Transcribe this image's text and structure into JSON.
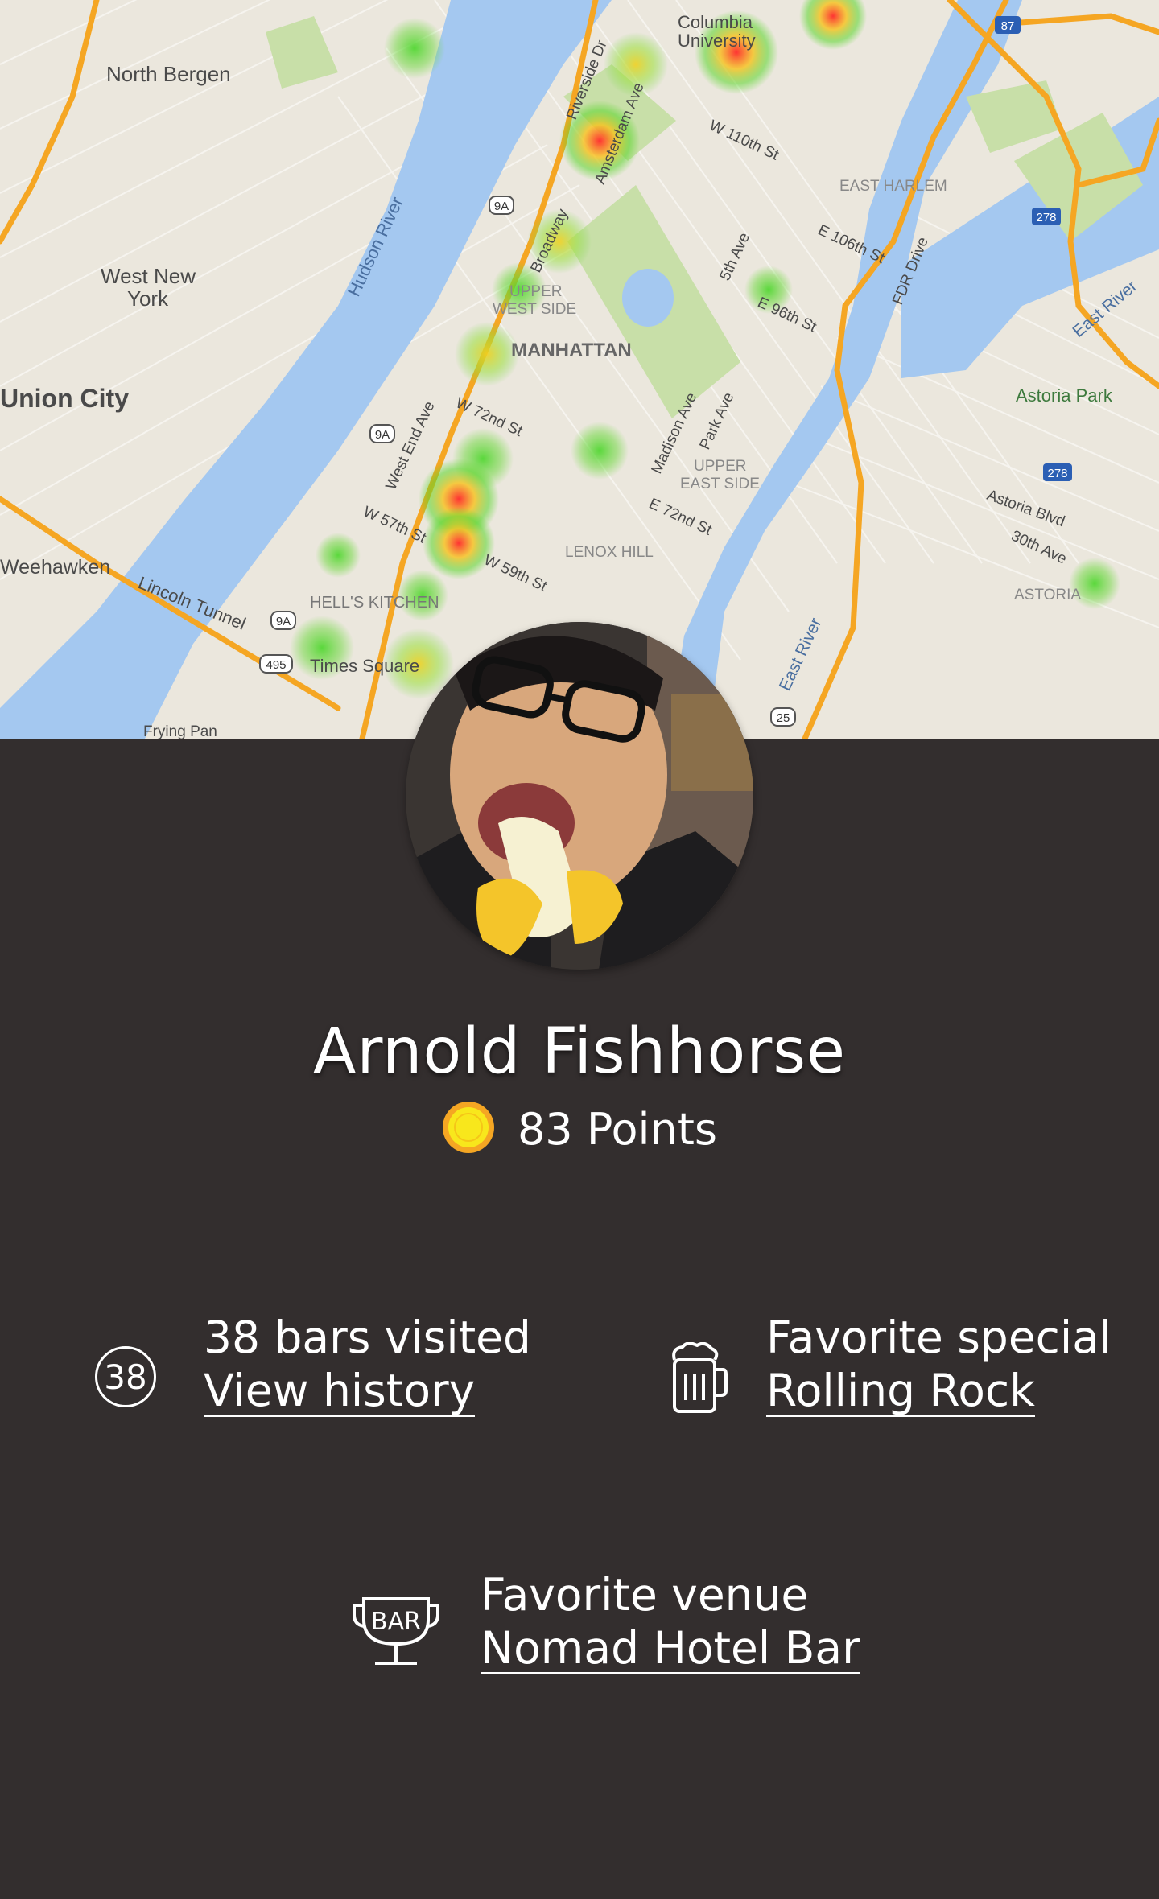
{
  "map": {
    "labels": {
      "north_bergen": "North Bergen",
      "west_new_york_1": "West New",
      "west_new_york_2": "York",
      "union_city": "Union City",
      "weehawken": "Weehawken",
      "hudson_river": "Hudson River",
      "lincoln_tunnel": "Lincoln Tunnel",
      "hells_kitchen": "HELL'S KITCHEN",
      "times_square": "Times Square",
      "upper_west_side_1": "UPPER",
      "upper_west_side_2": "WEST SIDE",
      "manhattan": "MANHATTAN",
      "upper_east_side_1": "UPPER",
      "upper_east_side_2": "EAST SIDE",
      "lenox_hill": "LENOX HILL",
      "east_harlem": "EAST HARLEM",
      "columbia_1": "Columbia",
      "columbia_2": "University",
      "astoria_park": "Astoria Park",
      "astoria": "ASTORIA",
      "east_river_1": "East River",
      "east_river_2": "East River",
      "fdr_drive": "FDR Drive",
      "broadway": "Broadway",
      "riverside_dr": "Riverside Dr",
      "amsterdam_ave": "Amsterdam Ave",
      "w_110th_st": "W 110th St",
      "w_72nd_st": "W 72nd St",
      "w_57th_st": "W 57th St",
      "w_59th_st": "W 59th St",
      "e_96th_st": "E 96th St",
      "e_72nd_st": "E 72nd St",
      "e_106th_st": "E 106th St",
      "fifth_ave": "5th Ave",
      "madison_ave": "Madison Ave",
      "park_ave": "Park Ave",
      "west_end_ave": "West End Ave",
      "astoria_blvd": "Astoria Blvd",
      "thirtieth_ave": "30th Ave",
      "frying_pan": "Frying Pan",
      "shield_9a": "9A",
      "shield_495": "495",
      "shield_278": "278",
      "shield_87": "87",
      "shield_25": "25"
    }
  },
  "profile": {
    "name": "Arnold Fishhorse",
    "points_label": "83 Points",
    "bars_visited_count": "38",
    "bars_visited_label": "38 bars visited",
    "view_history_link": "View history",
    "favorite_special_label": "Favorite special",
    "favorite_special_value": "Rolling Rock",
    "favorite_venue_label": "Favorite venue",
    "favorite_venue_value": "Nomad Hotel Bar",
    "venue_icon_text": "BAR"
  },
  "colors": {
    "background": "#332e2e",
    "coin_outer": "#f5a623",
    "coin_inner": "#f8e71c",
    "water": "#a4c8f0",
    "park": "#c8dfa8",
    "highway": "#f5a623"
  }
}
